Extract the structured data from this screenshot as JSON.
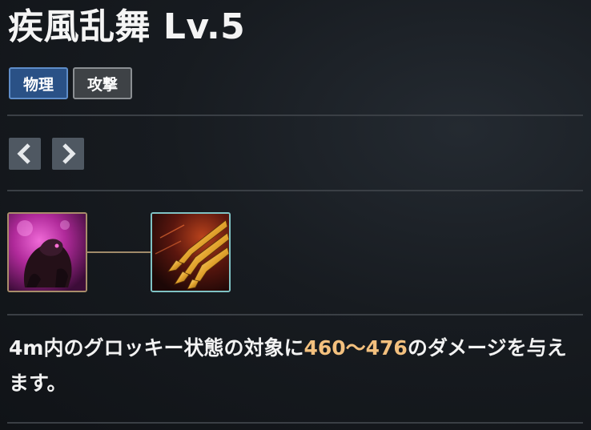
{
  "skill": {
    "title": "疾風乱舞 Lv.5"
  },
  "tags": [
    {
      "label": "物理"
    },
    {
      "label": "攻撃"
    }
  ],
  "nav": {
    "prev_icon": "chevron-left-icon",
    "next_icon": "chevron-right-icon"
  },
  "tree": {
    "base_icon": "dark-beast-skill-icon",
    "current_icon": "golden-claws-skill-icon"
  },
  "description": {
    "prefix": "4m内のグロッキー状態の対象に",
    "damage": "460〜476",
    "suffix": "のダメージを与えます。"
  },
  "colors": {
    "highlight": "#f3c07e",
    "tag_physical": "#2a5186",
    "tag_attack": "#3e4246",
    "base_border": "#a88d6a",
    "current_border": "#7fc2c4"
  }
}
